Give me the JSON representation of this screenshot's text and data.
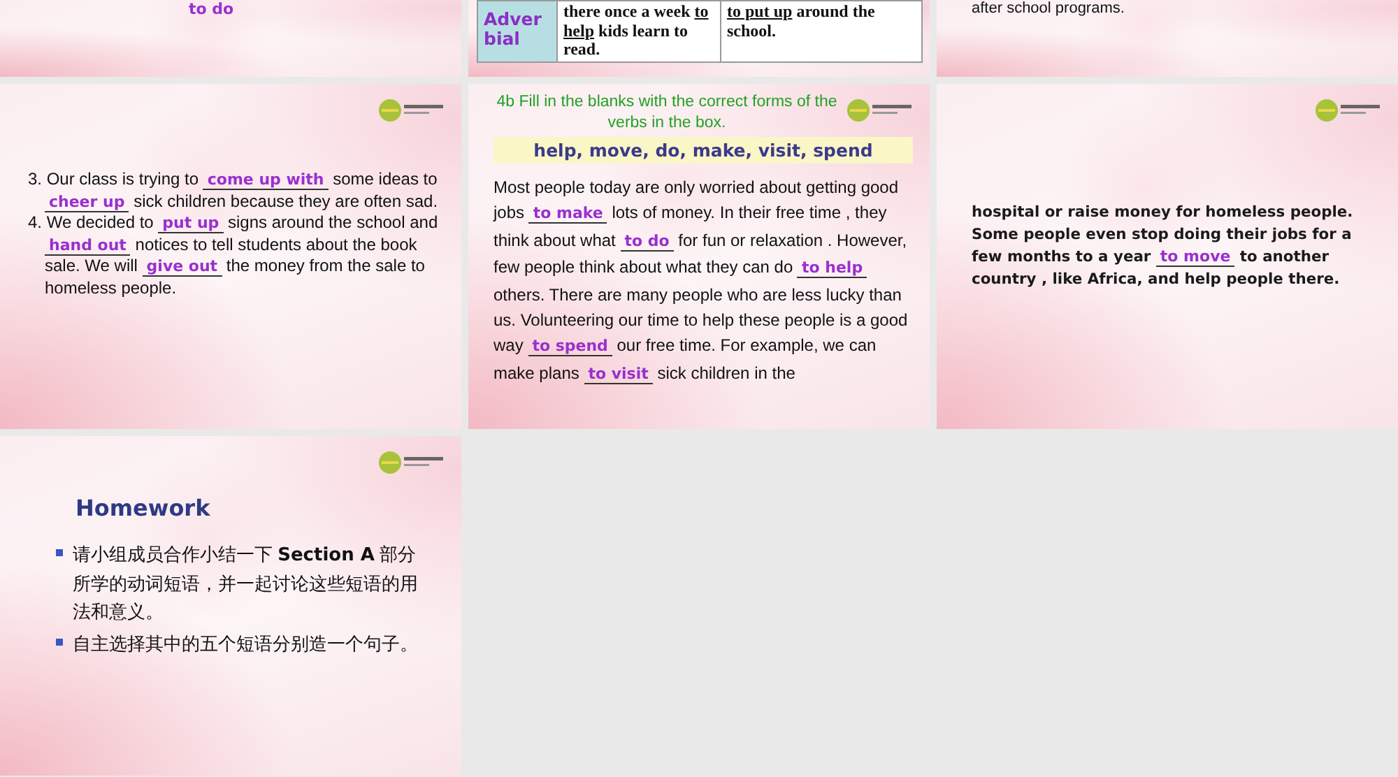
{
  "slides": [
    {
      "kind": "partial_text",
      "texts": [
        "to do"
      ]
    },
    {
      "kind": "partial_table",
      "label": "Adver bial",
      "cells": [
        [
          {
            "kind": "plain",
            "text": "there once a week "
          },
          {
            "kind": "underlined",
            "text": "to help"
          },
          {
            "kind": "plain",
            "text": " kids learn to read."
          }
        ],
        [
          {
            "kind": "underlined",
            "text": "to put up"
          },
          {
            "kind": "plain",
            "text": " around the school."
          }
        ]
      ]
    },
    {
      "kind": "partial_text",
      "texts": [
        "after school programs."
      ]
    },
    {
      "kind": "exercise",
      "logo": true,
      "items": [
        [
          {
            "kind": "plain",
            "text": "3. Our class is trying to "
          },
          {
            "kind": "answer",
            "text": "come up with"
          },
          {
            "kind": "plain",
            "text": " some ideas to "
          },
          {
            "kind": "answer",
            "text": "cheer up"
          },
          {
            "kind": "plain",
            "text": " sick children because they are often sad."
          }
        ],
        [
          {
            "kind": "plain",
            "text": "4. We decided to "
          },
          {
            "kind": "answer",
            "text": "put up"
          },
          {
            "kind": "plain",
            "text": " signs around the school and "
          },
          {
            "kind": "answer",
            "text": "hand out"
          },
          {
            "kind": "plain",
            "text": " notices to tell students about the book sale. We will "
          },
          {
            "kind": "answer",
            "text": "give out"
          },
          {
            "kind": "plain",
            "text": " the money from the sale to homeless people."
          }
        ]
      ]
    },
    {
      "kind": "passage",
      "logo": true,
      "title": "4b  Fill in the blanks with the correct forms of the verbs in the box.",
      "word_box": "help, move, do, make, visit, spend",
      "items": [
        [
          {
            "kind": "plain",
            "text": "Most people today are only worried about getting good jobs "
          },
          {
            "kind": "answer",
            "text": "to make"
          },
          {
            "kind": "plain",
            "text": " lots of money. In their free time , they think about what "
          },
          {
            "kind": "answer",
            "text": "to do"
          },
          {
            "kind": "plain",
            "text": " for fun or relaxation . However, few people think about what  they can do "
          },
          {
            "kind": "answer",
            "text": "to help"
          },
          {
            "kind": "plain",
            "text": " others. There are many people who are less lucky than us. Volunteering our time to help these people is a good way "
          },
          {
            "kind": "answer",
            "text": "to spend"
          },
          {
            "kind": "plain",
            "text": " our free time. For example, we can make plans "
          },
          {
            "kind": "answer",
            "text": "to visit"
          },
          {
            "kind": "plain",
            "text": " sick children in the"
          }
        ]
      ]
    },
    {
      "kind": "continued",
      "logo": true,
      "items": [
        [
          {
            "kind": "plain",
            "text": "hospital or raise money for homeless people. Some people even stop doing their jobs for a few months to a year "
          },
          {
            "kind": "answer",
            "text": "to move"
          },
          {
            "kind": "plain",
            "text": " to another country , like Africa, and help people there."
          }
        ]
      ]
    },
    {
      "kind": "homework",
      "logo": true,
      "title": "Homework",
      "bullets": [
        "请小组成员合作小结一下 **Section A** 部分所学的动词短语，并一起讨论这些短语的用法和意义。",
        "自主选择其中的五个短语分别造一个句子。"
      ]
    }
  ]
}
